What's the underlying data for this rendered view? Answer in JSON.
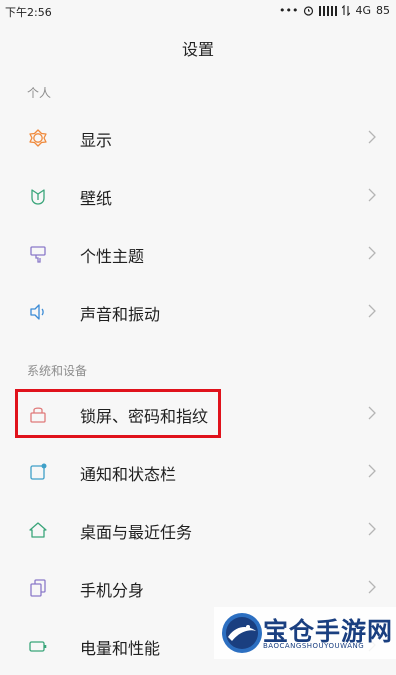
{
  "status_bar": {
    "time": "下午2:56",
    "network": "4G",
    "battery": "85",
    "icons": [
      "ellipsis-icon",
      "alarm-icon",
      "signal-icon",
      "data-arrows-icon"
    ]
  },
  "header": {
    "title": "设置"
  },
  "sections": {
    "personal": "个人",
    "system": "系统和设备"
  },
  "items": [
    {
      "label": "显示",
      "icon": "brightness-icon",
      "color": "#f08a3c"
    },
    {
      "label": "壁纸",
      "icon": "tulip-icon",
      "color": "#3aa57a"
    },
    {
      "label": "个性主题",
      "icon": "theme-brush-icon",
      "color": "#8a79c9"
    },
    {
      "label": "声音和振动",
      "icon": "speaker-icon",
      "color": "#3b8bd6"
    },
    {
      "label": "锁屏、密码和指纹",
      "icon": "lock-icon",
      "color": "#e07a7a"
    },
    {
      "label": "通知和状态栏",
      "icon": "notification-icon",
      "color": "#3fa0c8"
    },
    {
      "label": "桌面与最近任务",
      "icon": "home-icon",
      "color": "#3aa57a"
    },
    {
      "label": "手机分身",
      "icon": "dual-phone-icon",
      "color": "#8a79c9"
    },
    {
      "label": "电量和性能",
      "icon": "battery-icon",
      "color": "#3aa57a"
    }
  ],
  "highlight_color": "#e0121c",
  "watermark": {
    "text": "宝仓手游网",
    "sub": "BAOCANGSHOUYOUWANG"
  }
}
